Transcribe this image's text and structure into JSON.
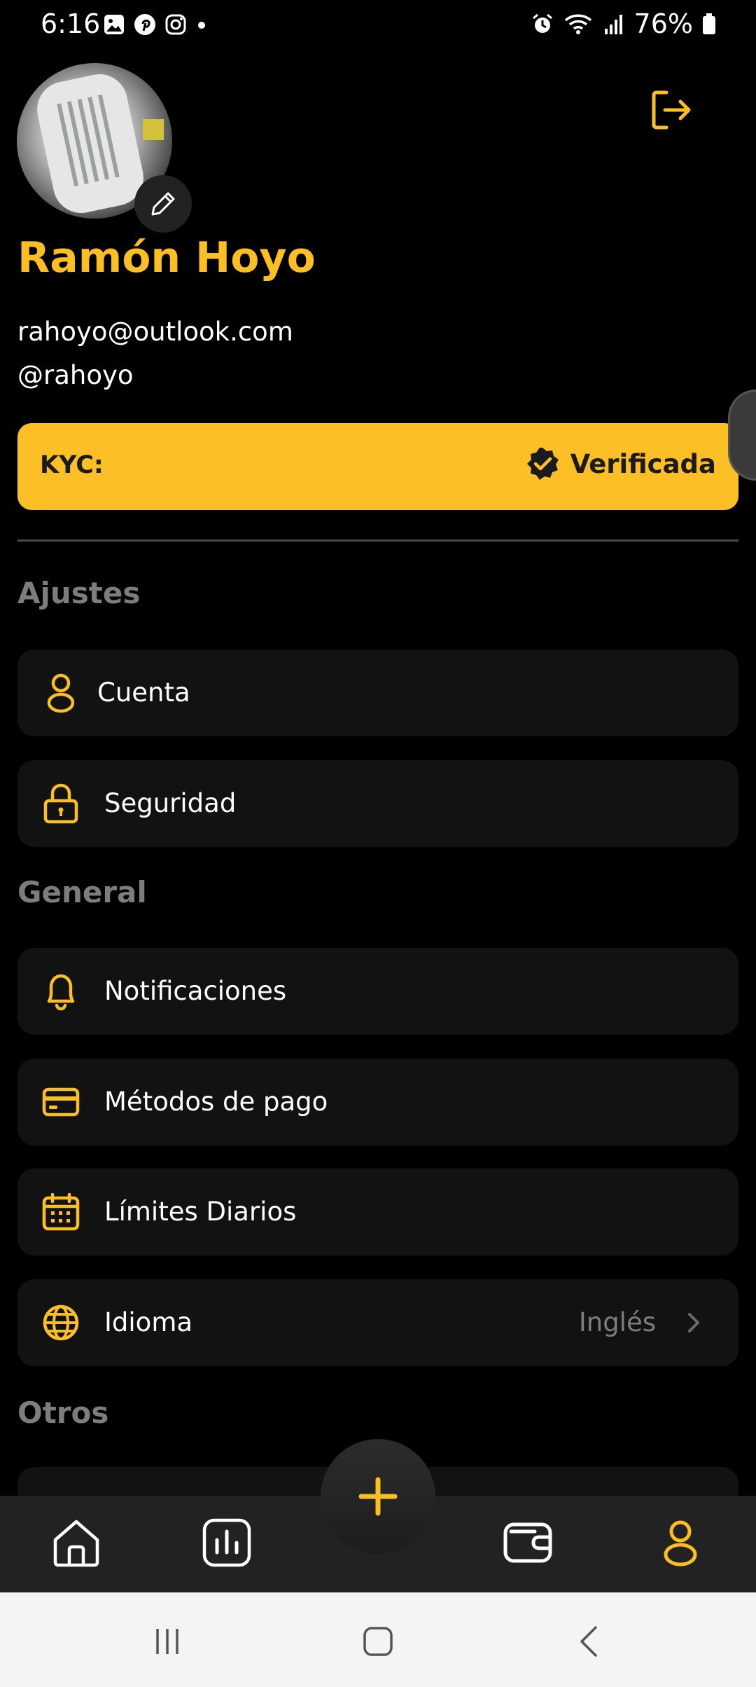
{
  "status_bar": {
    "time": "6:16",
    "battery": "76%",
    "left_icons": [
      "gallery-icon",
      "pinterest-icon",
      "instagram-icon",
      "dot-icon"
    ],
    "right_icons": [
      "alarm-icon",
      "wifi-icon",
      "signal-icon",
      "battery-icon"
    ]
  },
  "profile": {
    "name": "Ramón Hoyo",
    "email": "rahoyo@outlook.com",
    "handle": "@rahoyo",
    "avatar_icon": "avatar",
    "edit_icon": "pencil-icon",
    "logout_icon": "logout-icon"
  },
  "kyc": {
    "label": "KYC:",
    "status": "Verificada",
    "status_icon": "verified-badge-icon"
  },
  "sections": {
    "settings_title": "Ajustes",
    "general_title": "General",
    "others_title": "Otros"
  },
  "menu": {
    "account": "Cuenta",
    "security": "Seguridad",
    "notifications": "Notificaciones",
    "payment_methods": "Métodos de pago",
    "daily_limits": "Límites Diarios",
    "language": "Idioma",
    "language_value": "Inglés"
  },
  "bottom_nav": {
    "items": [
      "home-icon",
      "stats-icon",
      "add-icon",
      "wallet-icon",
      "profile-icon"
    ]
  },
  "colors": {
    "accent": "#fbbf24",
    "background": "#000000",
    "card": "#121212",
    "muted": "#7d7d7d"
  }
}
